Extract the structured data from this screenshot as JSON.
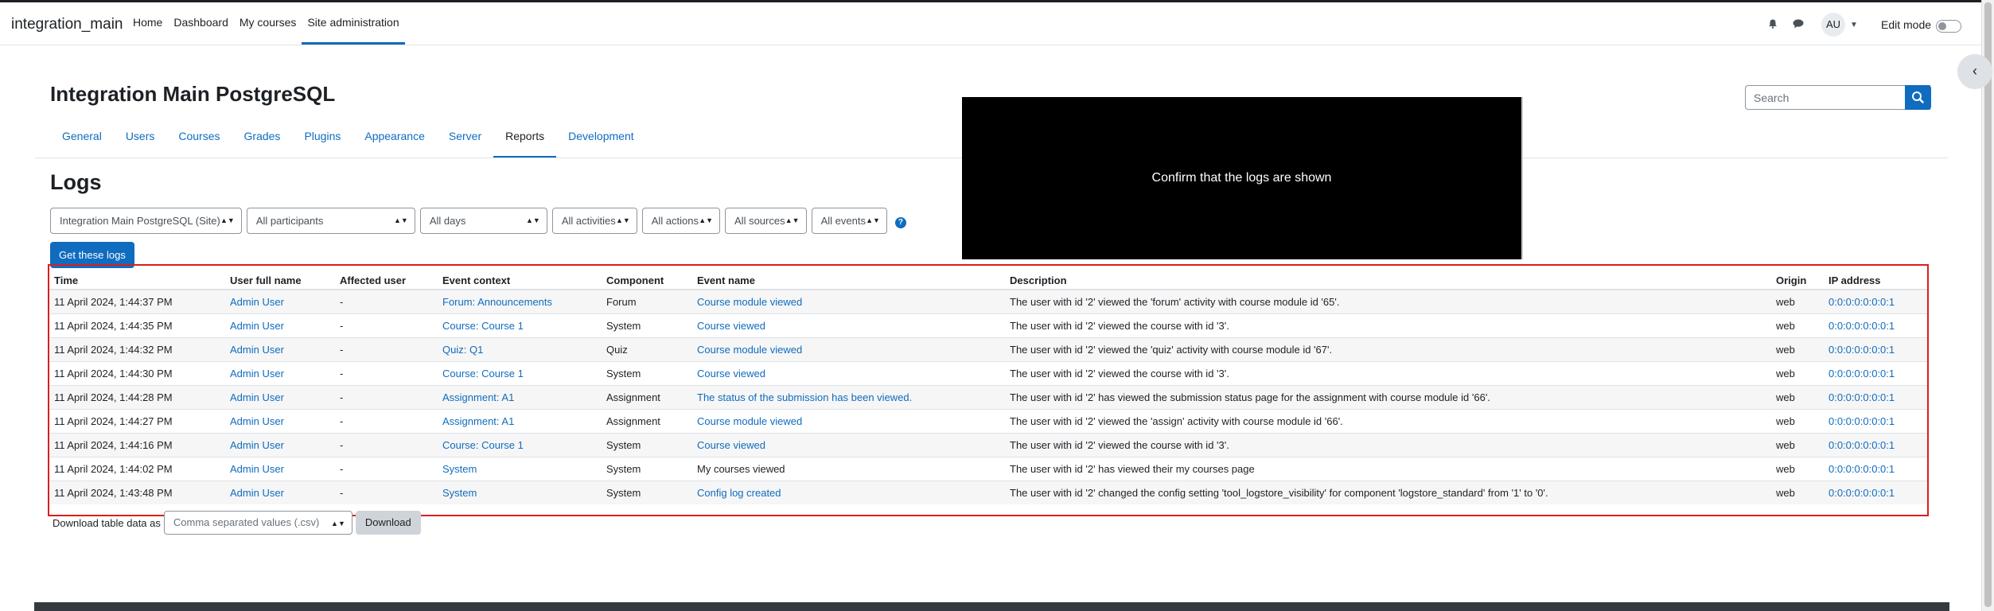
{
  "navbar": {
    "brand": "integration_main",
    "items": [
      "Home",
      "Dashboard",
      "My courses",
      "Site administration"
    ],
    "avatar_initials": "AU",
    "edit_mode_label": "Edit mode"
  },
  "header": {
    "title": "Integration Main PostgreSQL",
    "search_placeholder": "Search"
  },
  "secondary_nav": {
    "tabs": [
      "General",
      "Users",
      "Courses",
      "Grades",
      "Plugins",
      "Appearance",
      "Server",
      "Reports",
      "Development"
    ]
  },
  "logs": {
    "title": "Logs",
    "filters": [
      "Integration Main PostgreSQL (Site)",
      "All participants",
      "All days",
      "All activities",
      "All actions",
      "All sources",
      "All events"
    ],
    "get_button": "Get these logs"
  },
  "overlay": {
    "text": "Confirm that the logs are shown"
  },
  "table": {
    "headers": [
      "Time",
      "User full name",
      "Affected user",
      "Event context",
      "Component",
      "Event name",
      "Description",
      "Origin",
      "IP address"
    ],
    "rows": [
      [
        "11 April 2024, 1:44:37 PM",
        "Admin User",
        "-",
        "Forum: Announcements",
        "Forum",
        "Course module viewed",
        "The user with id '2' viewed the 'forum' activity with course module id '65'.",
        "web",
        "0:0:0:0:0:0:0:1"
      ],
      [
        "11 April 2024, 1:44:35 PM",
        "Admin User",
        "-",
        "Course: Course 1",
        "System",
        "Course viewed",
        "The user with id '2' viewed the course with id '3'.",
        "web",
        "0:0:0:0:0:0:0:1"
      ],
      [
        "11 April 2024, 1:44:32 PM",
        "Admin User",
        "-",
        "Quiz: Q1",
        "Quiz",
        "Course module viewed",
        "The user with id '2' viewed the 'quiz' activity with course module id '67'.",
        "web",
        "0:0:0:0:0:0:0:1"
      ],
      [
        "11 April 2024, 1:44:30 PM",
        "Admin User",
        "-",
        "Course: Course 1",
        "System",
        "Course viewed",
        "The user with id '2' viewed the course with id '3'.",
        "web",
        "0:0:0:0:0:0:0:1"
      ],
      [
        "11 April 2024, 1:44:28 PM",
        "Admin User",
        "-",
        "Assignment: A1",
        "Assignment",
        "The status of the submission has been viewed.",
        "The user with id '2' has viewed the submission status page for the assignment with course module id '66'.",
        "web",
        "0:0:0:0:0:0:0:1"
      ],
      [
        "11 April 2024, 1:44:27 PM",
        "Admin User",
        "-",
        "Assignment: A1",
        "Assignment",
        "Course module viewed",
        "The user with id '2' viewed the 'assign' activity with course module id '66'.",
        "web",
        "0:0:0:0:0:0:0:1"
      ],
      [
        "11 April 2024, 1:44:16 PM",
        "Admin User",
        "-",
        "Course: Course 1",
        "System",
        "Course viewed",
        "The user with id '2' viewed the course with id '3'.",
        "web",
        "0:0:0:0:0:0:0:1"
      ],
      [
        "11 April 2024, 1:44:02 PM",
        "Admin User",
        "-",
        "System",
        "System",
        "My courses viewed",
        "The user with id '2' has viewed their my courses page",
        "web",
        "0:0:0:0:0:0:0:1"
      ],
      [
        "11 April 2024, 1:43:48 PM",
        "Admin User",
        "-",
        "System",
        "System",
        "Config log created",
        "The user with id '2' changed the config setting 'tool_logstore_visibility' for component 'logstore_standard' from '1' to '0'.",
        "web",
        "0:0:0:0:0:0:0:1"
      ]
    ],
    "event_name_linked": [
      true,
      true,
      true,
      true,
      true,
      true,
      true,
      false,
      true
    ]
  },
  "download": {
    "label": "Download table data as",
    "format": "Comma separated values (.csv)",
    "button": "Download"
  },
  "colors": {
    "accent": "#0f6cbf",
    "highlight_border": "#dc1e1e"
  }
}
